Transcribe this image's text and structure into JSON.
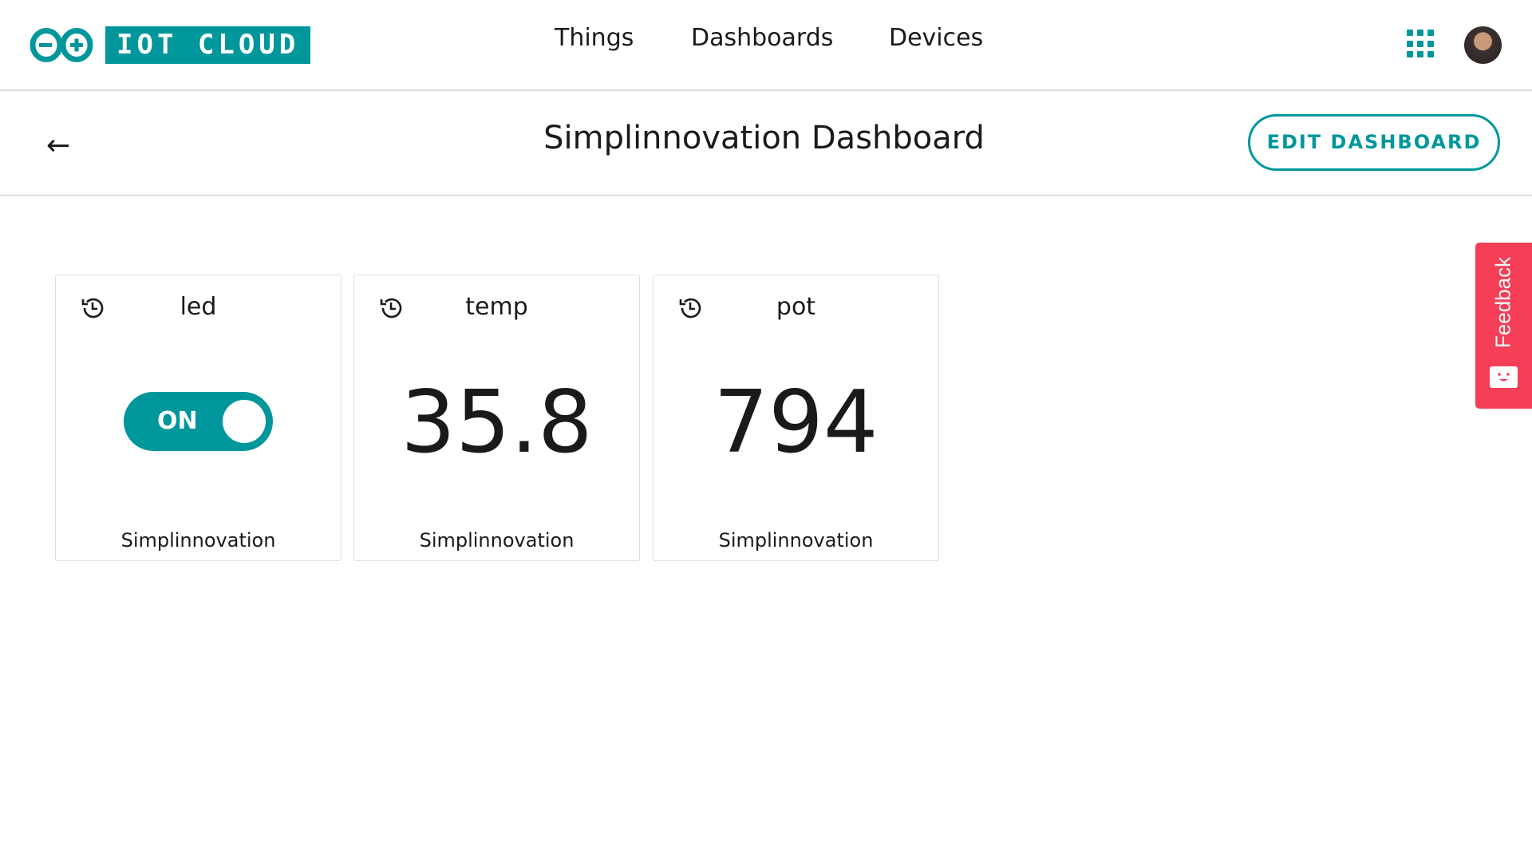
{
  "header": {
    "logo_text": "IOT CLOUD",
    "nav": [
      "Things",
      "Dashboards",
      "Devices"
    ],
    "accent": "#00979c"
  },
  "page": {
    "title": "Simplinnovation Dashboard",
    "edit_label": "EDIT DASHBOARD"
  },
  "widgets": [
    {
      "name": "led",
      "type": "switch",
      "value": "ON",
      "state": true,
      "thing": "Simplinnovation"
    },
    {
      "name": "temp",
      "type": "value",
      "value": "35.8",
      "thing": "Simplinnovation"
    },
    {
      "name": "pot",
      "type": "value",
      "value": "794",
      "thing": "Simplinnovation"
    }
  ],
  "feedback": {
    "label": "Feedback",
    "color": "#f43f57"
  }
}
